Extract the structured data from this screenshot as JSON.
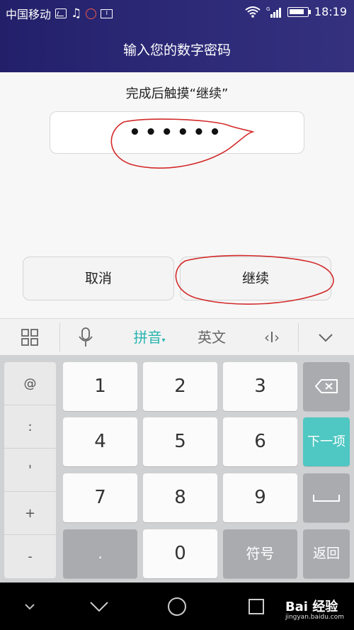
{
  "status_bar": {
    "carrier": "中国移动",
    "network": "G",
    "time": "18:19",
    "icons": [
      "image-icon",
      "music-note-icon",
      "face-icon",
      "sim-icon",
      "wifi-icon",
      "signal-icon",
      "battery-icon"
    ]
  },
  "header": {
    "title": "输入您的数字密码"
  },
  "dialog": {
    "hint": "完成后触摸“继续”",
    "password_value": "••••••",
    "cancel_label": "取消",
    "continue_label": "继续"
  },
  "keyboard_toolbar": {
    "pinyin_label": "拼音",
    "english_label": "英文",
    "cursor_label": "‹I›",
    "icons": [
      "grid-icon",
      "microphone-icon",
      "collapse-chevron-icon"
    ]
  },
  "keyboard": {
    "side_keys": [
      "@",
      ":",
      "'",
      "+",
      "-"
    ],
    "rows": [
      [
        "1",
        "2",
        "3"
      ],
      [
        "4",
        "5",
        "6"
      ],
      [
        "7",
        "8",
        "9"
      ],
      [
        ".",
        "0",
        "符号"
      ]
    ],
    "next_label": "下一项",
    "return_label": "返回",
    "icons": [
      "backspace-icon",
      "space-icon"
    ]
  },
  "nav_bar": {
    "icons": [
      "hide-keyboard-icon",
      "back-icon",
      "home-icon",
      "recents-icon"
    ],
    "watermark_main": "Bai 经验",
    "watermark_sub": "jingyan.baidu.com"
  },
  "colors": {
    "header_bg": "#2a2774",
    "accent_key": "#4fc7c2",
    "pinyin_active": "#29b5b0",
    "annotation_red": "#d32a2a"
  }
}
